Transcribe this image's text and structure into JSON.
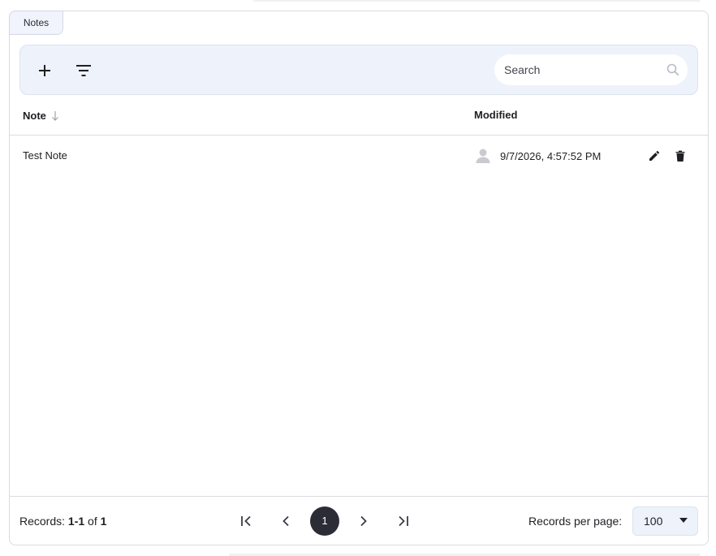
{
  "tab": {
    "label": "Notes"
  },
  "toolbar": {
    "add_icon": "plus-icon",
    "filter_icon": "filter-icon",
    "search": {
      "placeholder": "Search",
      "value": "",
      "icon": "search-icon"
    }
  },
  "table": {
    "columns": [
      {
        "label": "Note",
        "sort": "descending"
      },
      {
        "label": "Modified"
      }
    ],
    "rows": [
      {
        "note": "Test Note",
        "modified": "9/7/2026, 4:57:52 PM",
        "user_icon": "person-icon",
        "actions": [
          "edit-icon",
          "delete-icon"
        ]
      }
    ]
  },
  "footer": {
    "records_prefix": "Records: ",
    "records_range": "1-1",
    "records_of": " of ",
    "records_total": "1",
    "current_page": "1",
    "rpp_label": "Records per page:",
    "rpp_value": "100"
  },
  "colors": {
    "accent_bg": "#eef2fb",
    "current_page_bg": "#2b2c36",
    "border": "#dcdce0"
  }
}
